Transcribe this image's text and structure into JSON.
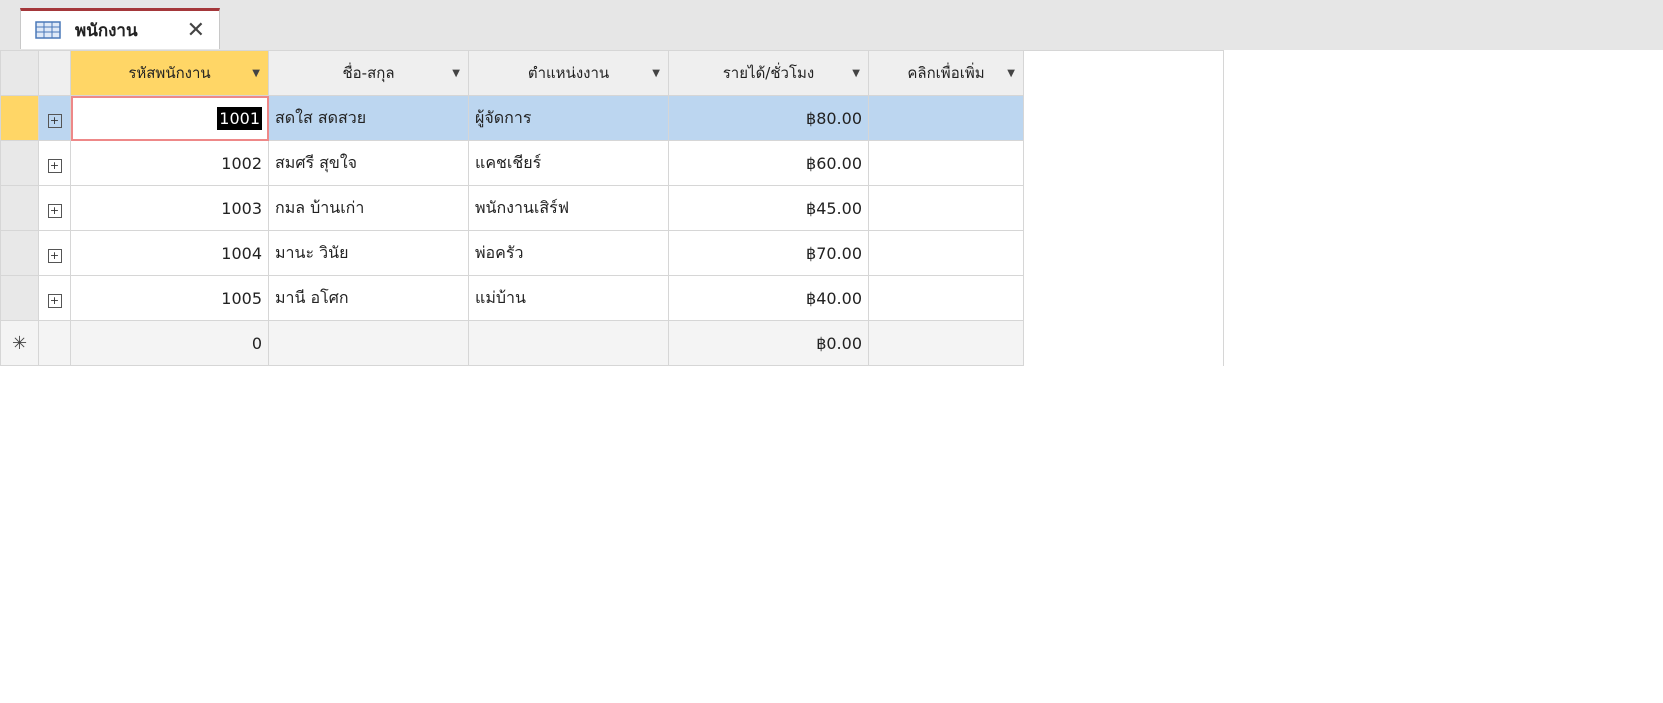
{
  "tab": {
    "label": "พนักงาน",
    "close": "✕"
  },
  "columns": [
    "รหัสพนักงาน",
    "ชื่อ-สกุล",
    "ตำแหน่งงาน",
    "รายได้/ชั่วโมง",
    "คลิกเพื่อเพิ่ม"
  ],
  "rows": [
    {
      "id": "1001",
      "name": "สดใส สดสวย",
      "position": "ผู้จัดการ",
      "wage": "฿80.00"
    },
    {
      "id": "1002",
      "name": "สมศรี สุขใจ",
      "position": "แคชเชียร์",
      "wage": "฿60.00"
    },
    {
      "id": "1003",
      "name": "กมล บ้านเก่า",
      "position": "พนักงานเสิร์ฟ",
      "wage": "฿45.00"
    },
    {
      "id": "1004",
      "name": "มานะ วินัย",
      "position": "พ่อครัว",
      "wage": "฿70.00"
    },
    {
      "id": "1005",
      "name": "มานี อโศก",
      "position": "แม่บ้าน",
      "wage": "฿40.00"
    }
  ],
  "new_row": {
    "marker": "✳",
    "id": "0",
    "wage": "฿0.00"
  },
  "colors": {
    "accent": "#a4373a",
    "selected_row": "#bcd6f0",
    "active_header": "#ffd666"
  },
  "icons": {
    "table": "table-icon",
    "expand": "plus-box-icon"
  }
}
